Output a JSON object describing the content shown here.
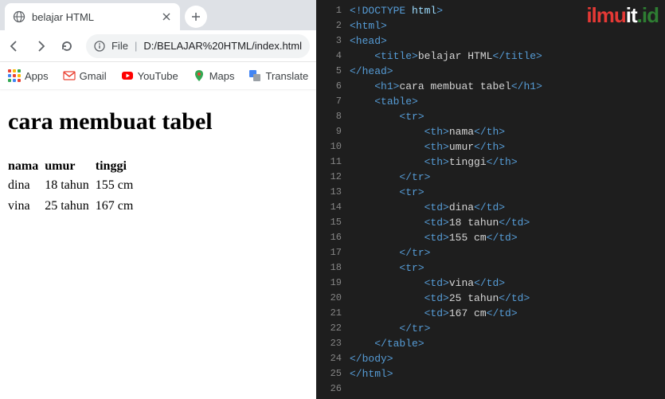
{
  "browser": {
    "tab_title": "belajar HTML",
    "address": {
      "prefix": "File",
      "url": "D:/BELAJAR%20HTML/index.html"
    },
    "bookmarks": {
      "apps_label": "Apps",
      "items": [
        {
          "label": "Gmail"
        },
        {
          "label": "YouTube"
        },
        {
          "label": "Maps"
        },
        {
          "label": "Translate"
        }
      ]
    }
  },
  "page": {
    "heading": "cara membuat tabel",
    "table": {
      "headers": [
        "nama",
        "umur",
        "tinggi"
      ],
      "rows": [
        [
          "dina",
          "18 tahun",
          "155 cm"
        ],
        [
          "vina",
          "25 tahun",
          "167 cm"
        ]
      ]
    }
  },
  "editor": {
    "lines": [
      {
        "indent": 0,
        "tokens": [
          {
            "t": "tag",
            "s": "<!"
          },
          {
            "t": "doctype",
            "s": "DOCTYPE"
          },
          {
            "t": "text",
            "s": " "
          },
          {
            "t": "attr",
            "s": "html"
          },
          {
            "t": "tag",
            "s": ">"
          }
        ]
      },
      {
        "indent": 0,
        "tokens": [
          {
            "t": "tag",
            "s": "<html>"
          }
        ]
      },
      {
        "indent": 0,
        "tokens": [
          {
            "t": "tag",
            "s": "<head>"
          }
        ]
      },
      {
        "indent": 1,
        "tokens": [
          {
            "t": "tag",
            "s": "<title>"
          },
          {
            "t": "text",
            "s": "belajar HTML"
          },
          {
            "t": "tag",
            "s": "</title>"
          }
        ]
      },
      {
        "indent": 0,
        "tokens": [
          {
            "t": "tag",
            "s": "</head>"
          }
        ]
      },
      {
        "indent": 1,
        "tokens": [
          {
            "t": "tag",
            "s": "<h1>"
          },
          {
            "t": "text",
            "s": "cara membuat tabel"
          },
          {
            "t": "tag",
            "s": "</h1>"
          }
        ]
      },
      {
        "indent": 1,
        "tokens": [
          {
            "t": "tag",
            "s": "<table>"
          }
        ]
      },
      {
        "indent": 2,
        "tokens": [
          {
            "t": "tag",
            "s": "<tr>"
          }
        ]
      },
      {
        "indent": 3,
        "tokens": [
          {
            "t": "tag",
            "s": "<th>"
          },
          {
            "t": "text",
            "s": "nama"
          },
          {
            "t": "tag",
            "s": "</th>"
          }
        ]
      },
      {
        "indent": 3,
        "tokens": [
          {
            "t": "tag",
            "s": "<th>"
          },
          {
            "t": "text",
            "s": "umur"
          },
          {
            "t": "tag",
            "s": "</th>"
          }
        ]
      },
      {
        "indent": 3,
        "tokens": [
          {
            "t": "tag",
            "s": "<th>"
          },
          {
            "t": "text",
            "s": "tinggi"
          },
          {
            "t": "tag",
            "s": "</th>"
          }
        ]
      },
      {
        "indent": 2,
        "tokens": [
          {
            "t": "tag",
            "s": "</tr>"
          }
        ]
      },
      {
        "indent": 2,
        "tokens": [
          {
            "t": "tag",
            "s": "<tr>"
          }
        ]
      },
      {
        "indent": 3,
        "tokens": [
          {
            "t": "tag",
            "s": "<td>"
          },
          {
            "t": "text",
            "s": "dina"
          },
          {
            "t": "tag",
            "s": "</td>"
          }
        ]
      },
      {
        "indent": 3,
        "tokens": [
          {
            "t": "tag",
            "s": "<td>"
          },
          {
            "t": "text",
            "s": "18 tahun"
          },
          {
            "t": "tag",
            "s": "</td>"
          }
        ]
      },
      {
        "indent": 3,
        "tokens": [
          {
            "t": "tag",
            "s": "<td>"
          },
          {
            "t": "text",
            "s": "155 cm"
          },
          {
            "t": "tag",
            "s": "</td>"
          }
        ]
      },
      {
        "indent": 2,
        "tokens": [
          {
            "t": "tag",
            "s": "</tr>"
          }
        ]
      },
      {
        "indent": 2,
        "tokens": [
          {
            "t": "tag",
            "s": "<tr>"
          }
        ]
      },
      {
        "indent": 3,
        "tokens": [
          {
            "t": "tag",
            "s": "<td>"
          },
          {
            "t": "text",
            "s": "vina"
          },
          {
            "t": "tag",
            "s": "</td>"
          }
        ]
      },
      {
        "indent": 3,
        "tokens": [
          {
            "t": "tag",
            "s": "<td>"
          },
          {
            "t": "text",
            "s": "25 tahun"
          },
          {
            "t": "tag",
            "s": "</td>"
          }
        ]
      },
      {
        "indent": 3,
        "tokens": [
          {
            "t": "tag",
            "s": "<td>"
          },
          {
            "t": "text",
            "s": "167 cm"
          },
          {
            "t": "tag",
            "s": "</td>"
          }
        ]
      },
      {
        "indent": 2,
        "tokens": [
          {
            "t": "tag",
            "s": "</tr>"
          }
        ]
      },
      {
        "indent": 1,
        "tokens": [
          {
            "t": "tag",
            "s": "</table>"
          }
        ]
      },
      {
        "indent": 0,
        "tokens": [
          {
            "t": "tag",
            "s": "</body>"
          }
        ]
      },
      {
        "indent": 0,
        "tokens": [
          {
            "t": "tag",
            "s": "</html>"
          }
        ]
      },
      {
        "indent": 0,
        "tokens": []
      }
    ]
  },
  "watermark": {
    "a": "ilmu",
    "b": "it",
    "c": ".id"
  }
}
